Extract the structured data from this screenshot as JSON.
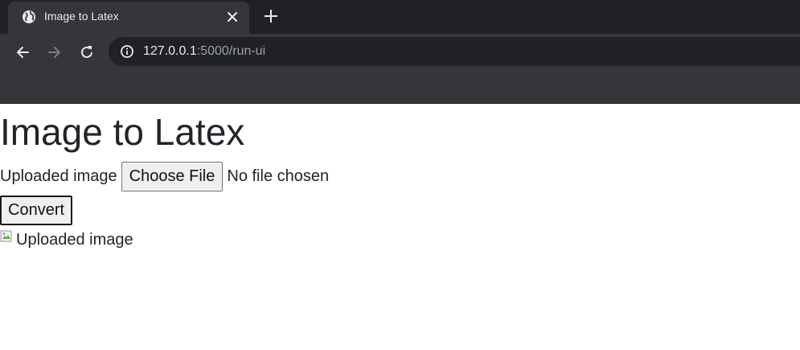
{
  "browser": {
    "tab": {
      "icon": "globe-icon",
      "title": "Image to Latex",
      "close_icon": "close-icon"
    },
    "new_tab_icon": "plus-icon",
    "nav": {
      "back_icon": "back-arrow-icon",
      "forward_icon": "forward-arrow-icon",
      "reload_icon": "reload-icon"
    },
    "address": {
      "icon": "info-icon",
      "host": "127.0.0.1",
      "path": ":5000/run-ui"
    }
  },
  "page": {
    "title": "Image to Latex",
    "upload": {
      "label": "Uploaded image",
      "button": "Choose File",
      "status": "No file chosen"
    },
    "convert_button": "Convert",
    "image_alt": "Uploaded image"
  },
  "colors": {
    "tabstrip": "#202124",
    "toolbar": "#35363a",
    "omnibox": "#202124",
    "text": "#212529"
  }
}
